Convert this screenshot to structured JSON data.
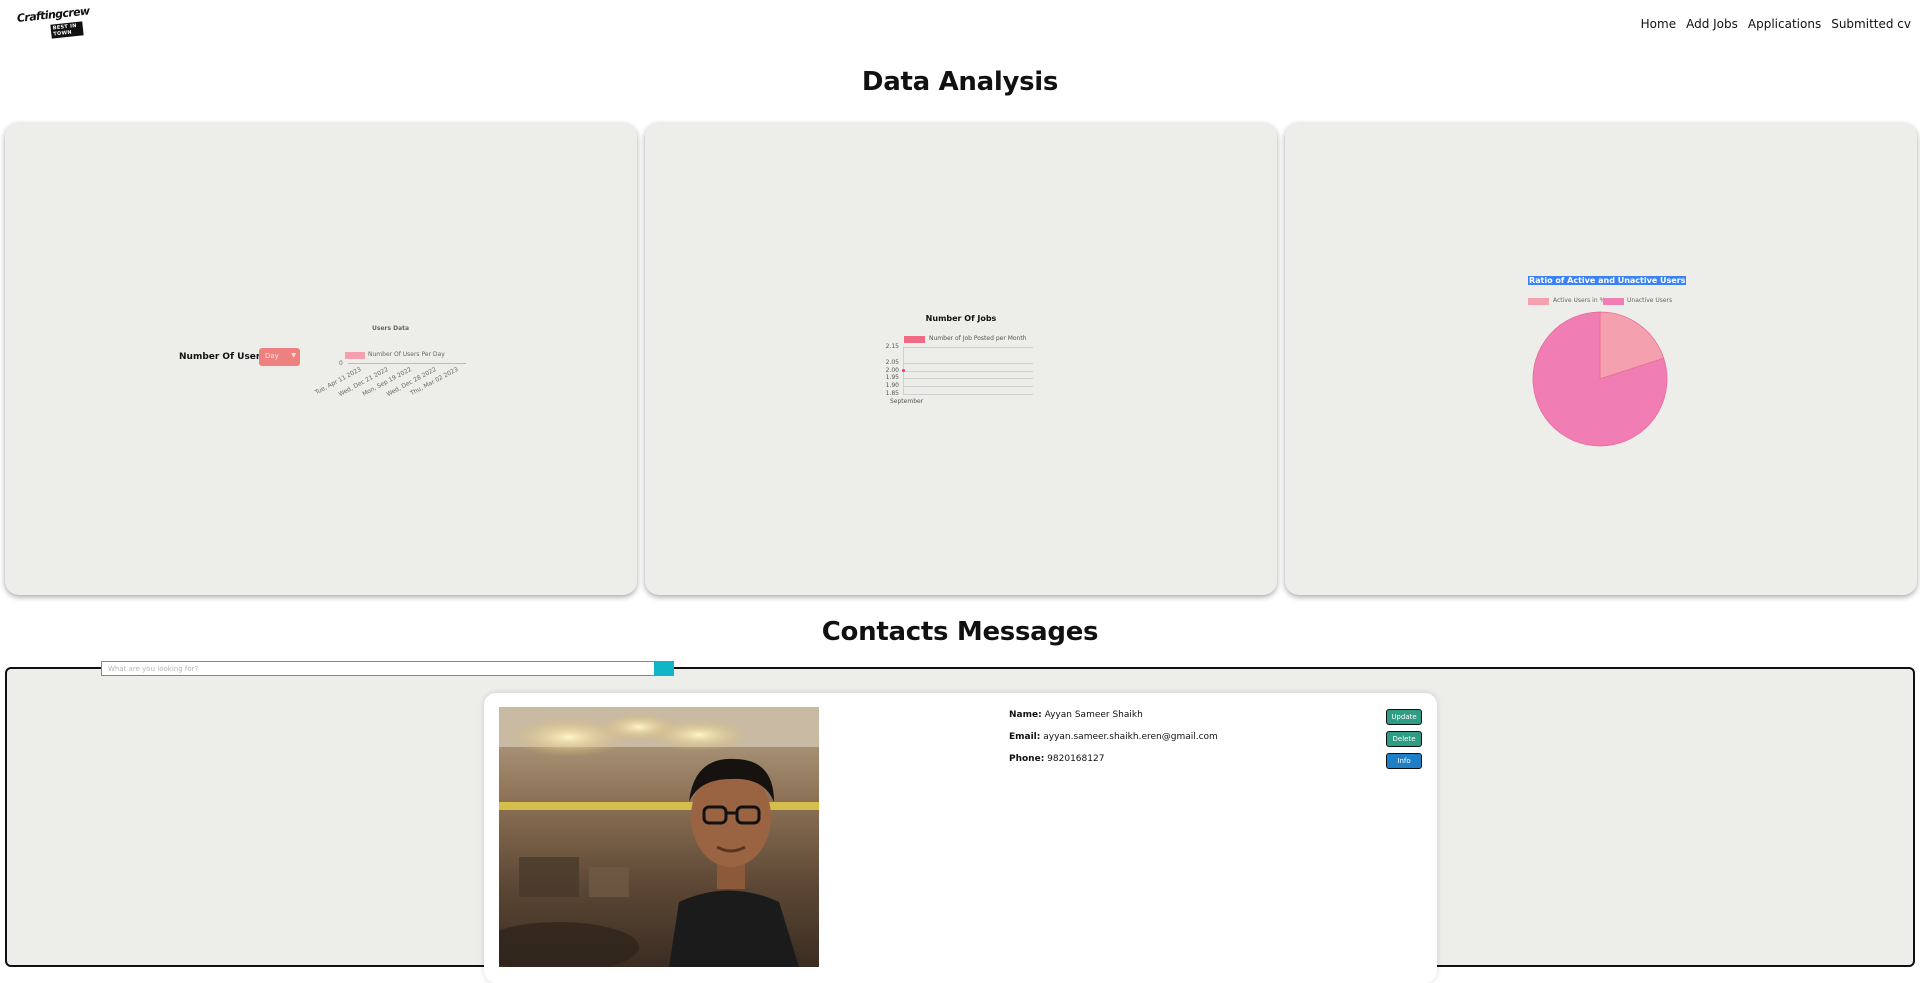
{
  "navbar": {
    "logo_text": "Craftingcrew",
    "logo_tag": "BEST IN TOWN",
    "links": [
      "Home",
      "Add Jobs",
      "Applications",
      "Submitted cv"
    ]
  },
  "data_analysis": {
    "title": "Data Analysis",
    "users_card": {
      "label": "Number Of Users",
      "select_value": "Day"
    },
    "jobs_card": {},
    "ratio_card": {}
  },
  "chart_data": [
    {
      "type": "bar",
      "title": "Users Data",
      "legend": [
        "Number Of Users Per Day"
      ],
      "y_tick_labels": [
        "0"
      ],
      "categories": [
        "Tue, Apr 11 2023",
        "Wed, Dec 21 2022",
        "Mon, Sep 19 2022",
        "Wed, Dec 28 2022",
        "Thu, Mar 02 2023"
      ],
      "series": [
        {
          "name": "Number Of Users Per Day",
          "values": [
            0,
            0,
            0,
            0,
            0
          ]
        }
      ],
      "colors": {
        "series": "#f5a0b0"
      }
    },
    {
      "type": "line",
      "title": "Number Of Jobs",
      "legend": [
        "Number of Job Posted per Month"
      ],
      "categories": [
        "September"
      ],
      "series": [
        {
          "name": "Number of Job Posted per Month",
          "values": [
            2
          ]
        }
      ],
      "y_tick_labels": [
        "2.15",
        "2.05",
        "2.00",
        "1.95",
        "1.90",
        "1.85"
      ],
      "ylim": [
        1.85,
        2.15
      ],
      "colors": {
        "series": "#f06a86"
      }
    },
    {
      "type": "pie",
      "title": "Ratio of Active and Unactive Users",
      "labels": [
        "Active Users in %",
        "Unactive Users"
      ],
      "values": [
        20,
        80
      ],
      "colors": [
        "#f5a0ae",
        "#f07eb5"
      ]
    }
  ],
  "contacts": {
    "title": "Contacts Messages",
    "search_placeholder": "What are you looking for?",
    "cards": [
      {
        "name_label": "Name:",
        "name": "Ayyan Sameer Shaikh",
        "email_label": "Email:",
        "email": "ayyan.sameer.shaikh.eren@gmail.com",
        "phone_label": "Phone:",
        "phone": "9820168127",
        "buttons": {
          "update": "Update",
          "delete": "Delete",
          "info": "Info"
        }
      }
    ]
  }
}
